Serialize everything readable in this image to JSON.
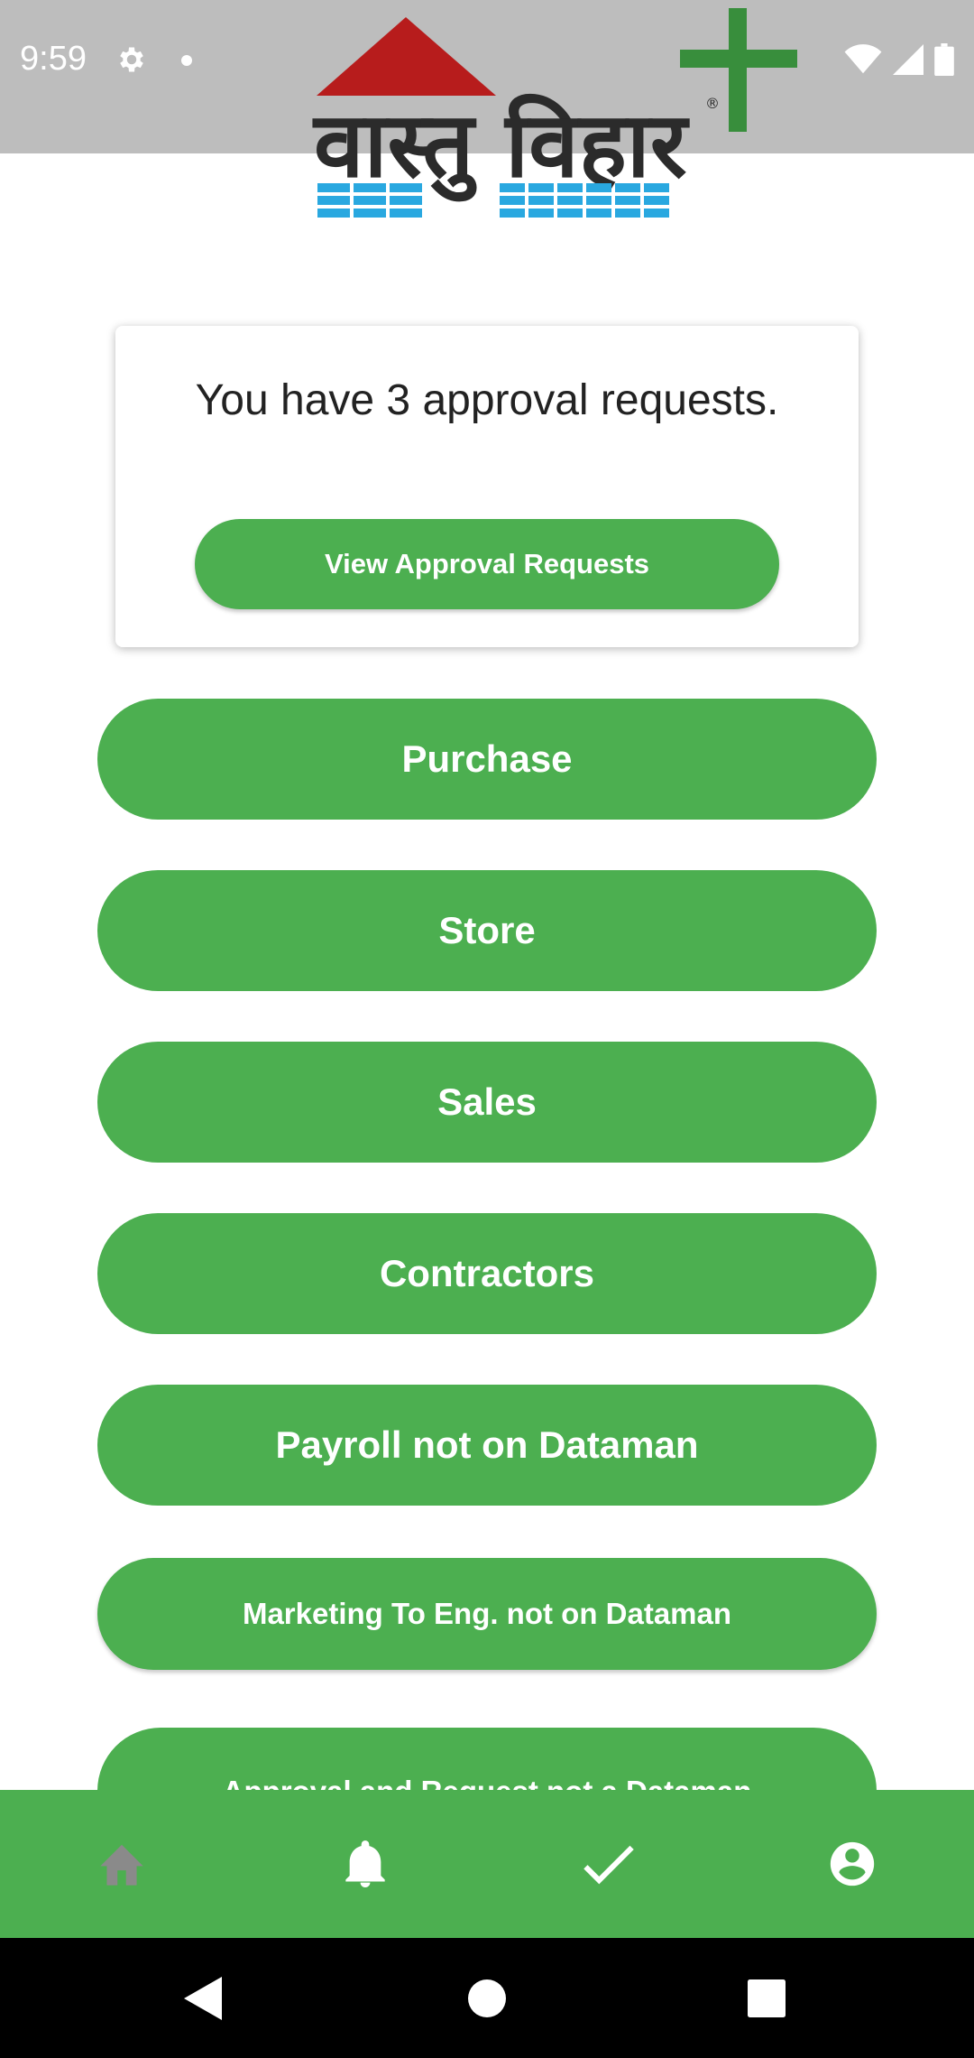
{
  "status_bar": {
    "time": "9:59",
    "icons": [
      "settings-icon",
      "notification-dot-icon",
      "wifi-icon",
      "cellular-signal-icon",
      "battery-icon"
    ]
  },
  "logo": {
    "text": "वास्तु विहार",
    "registered_mark": "®",
    "colors": {
      "roof": "#b71c1c",
      "text": "#2b2b2b",
      "bricks": "#29a8e0",
      "plus": "#388e3c"
    }
  },
  "approval_card": {
    "message": "You have 3 approval requests.",
    "button_label": "View Approval Requests"
  },
  "menu": {
    "items": [
      {
        "label": "Purchase"
      },
      {
        "label": "Store"
      },
      {
        "label": "Sales"
      },
      {
        "label": "Contractors"
      },
      {
        "label": "Payroll not on Dataman"
      },
      {
        "label": "Marketing To Eng. not on Dataman"
      },
      {
        "label": "Approval and Request not a Dataman"
      }
    ]
  },
  "bottom_nav": {
    "items": [
      {
        "icon": "home-icon",
        "active": true
      },
      {
        "icon": "bell-icon",
        "active": false
      },
      {
        "icon": "check-icon",
        "active": false
      },
      {
        "icon": "account-icon",
        "active": false
      }
    ]
  },
  "system_nav": {
    "items": [
      "back-icon",
      "home-circle-icon",
      "recents-icon"
    ]
  },
  "colors": {
    "accent": "#4caf50",
    "status_bar": "#bdbdbd",
    "active_nav_icon": "#8a8a8a",
    "nav_icon": "#ffffff"
  }
}
